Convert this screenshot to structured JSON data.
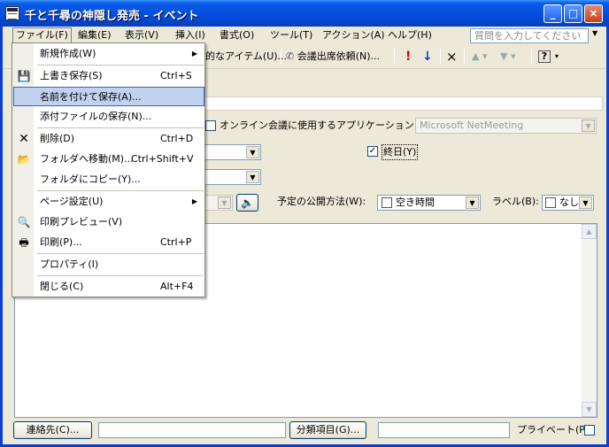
{
  "window": {
    "title": "千と千尋の神隠し発売 - イベント",
    "min": "_",
    "max": "□",
    "close": "×"
  },
  "menubar": {
    "file": "ファイル(F)",
    "edit": "編集(E)",
    "view": "表示(V)",
    "insert": "挿入(I)",
    "format": "書式(O)",
    "tools": "ツール(T)",
    "actions": "アクション(A)",
    "help": "ヘルプ(H)",
    "help_search_placeholder": "質問を入力してください"
  },
  "toolbar": {
    "recurrence_fragment": "的なアイテム(U)...",
    "meeting_request": "会議出席依頼(N)...",
    "importance_high": "!",
    "importance_low": "↓",
    "delete": "×",
    "help": "?"
  },
  "form": {
    "online_meeting_label": "オンライン会議に使用するアプリケーション：",
    "online_meeting_app": "Microsoft NetMeeting",
    "all_day_label": "終日(Y)",
    "all_day_checked": true,
    "show_time_as_label": "予定の公開方法(W):",
    "show_time_as_value": "空き時間",
    "label_label": "ラベル(B):",
    "label_value": "なし"
  },
  "bottom": {
    "contacts_button": "連絡先(C)...",
    "categories_button": "分類項目(G)...",
    "private_label": "プライベート(P)"
  },
  "file_menu": {
    "items": [
      {
        "label": "新規作成(W)",
        "shortcut": "",
        "submenu": true,
        "icon": ""
      },
      {
        "label": "上書き保存(S)",
        "shortcut": "Ctrl+S",
        "submenu": false,
        "icon": "save-icon"
      },
      {
        "label": "名前を付けて保存(A)...",
        "shortcut": "",
        "submenu": false,
        "icon": "",
        "highlighted": true
      },
      {
        "label": "添付ファイルの保存(N)...",
        "shortcut": "",
        "submenu": false,
        "icon": ""
      },
      {
        "label": "削除(D)",
        "shortcut": "Ctrl+D",
        "submenu": false,
        "icon": "delete-icon"
      },
      {
        "label": "フォルダへ移動(M)...",
        "shortcut": "Ctrl+Shift+V",
        "submenu": false,
        "icon": "move-folder-icon"
      },
      {
        "label": "フォルダにコピー(Y)...",
        "shortcut": "",
        "submenu": false,
        "icon": ""
      },
      {
        "label": "ページ設定(U)",
        "shortcut": "",
        "submenu": true,
        "icon": ""
      },
      {
        "label": "印刷プレビュー(V)",
        "shortcut": "",
        "submenu": false,
        "icon": "print-preview-icon"
      },
      {
        "label": "印刷(P)...",
        "shortcut": "Ctrl+P",
        "submenu": false,
        "icon": "print-icon"
      },
      {
        "label": "プロパティ(I)",
        "shortcut": "",
        "submenu": false,
        "icon": ""
      },
      {
        "label": "閉じる(C)",
        "shortcut": "Alt+F4",
        "submenu": false,
        "icon": ""
      }
    ]
  }
}
